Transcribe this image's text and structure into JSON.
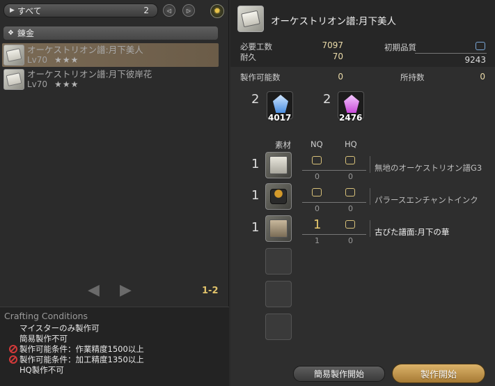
{
  "filter": {
    "label": "すべて",
    "count": "2"
  },
  "category": {
    "label": "錬金"
  },
  "recipes": [
    {
      "name": "オーケストリオン譜:月下美人",
      "level": "Lv70",
      "stars": "★★★",
      "selected": true
    },
    {
      "name": "オーケストリオン譜:月下彼岸花",
      "level": "Lv70",
      "stars": "★★★",
      "selected": false
    }
  ],
  "pagination": {
    "prev": "◀",
    "next": "▶",
    "page": "1-2"
  },
  "conditions": {
    "title": "Crafting Conditions",
    "lines": [
      {
        "text": "マイスターのみ製作可",
        "blocked": false
      },
      {
        "text": "簡易製作不可",
        "blocked": false
      },
      {
        "text": "製作可能条件：作業精度1500以上",
        "blocked": true
      },
      {
        "text": "製作可能条件：加工精度1350以上",
        "blocked": true
      },
      {
        "text": "HQ製作不可",
        "blocked": false
      }
    ]
  },
  "detail": {
    "title": "オーケストリオン譜:月下美人",
    "required_progress_label": "必要工数",
    "required_progress": "7097",
    "durability_label": "耐久",
    "durability": "70",
    "initial_quality_label": "初期品質",
    "initial_quality": "9243",
    "craftable_label": "製作可能数",
    "craftable": "0",
    "owned_label": "所持数",
    "owned": "0"
  },
  "crystals": [
    {
      "required": "2",
      "have": "4017",
      "color": "#4a8de0",
      "name": "ice-crystal"
    },
    {
      "required": "2",
      "have": "2476",
      "color": "#c84ad8",
      "name": "lightning-crystal"
    }
  ],
  "materials_header": {
    "material": "素材",
    "nq": "NQ",
    "hq": "HQ"
  },
  "materials": [
    {
      "qty": "1",
      "nq": "",
      "hq": "",
      "nq_have": "0",
      "hq_have": "0",
      "name": "無地のオーケストリオン譜G3",
      "icon": "blank-sheet-icon",
      "have_enough": false
    },
    {
      "qty": "1",
      "nq": "",
      "hq": "",
      "nq_have": "0",
      "hq_have": "0",
      "name": "パラースエンチャントインク",
      "icon": "ink-icon",
      "have_enough": false
    },
    {
      "qty": "1",
      "nq": "1",
      "hq": "",
      "nq_have": "1",
      "hq_have": "0",
      "name": "古びた譜面:月下の華",
      "icon": "old-score-icon",
      "have_enough": true
    }
  ],
  "buttons": {
    "quick_synth": "簡易製作開始",
    "synthesize": "製作開始"
  }
}
